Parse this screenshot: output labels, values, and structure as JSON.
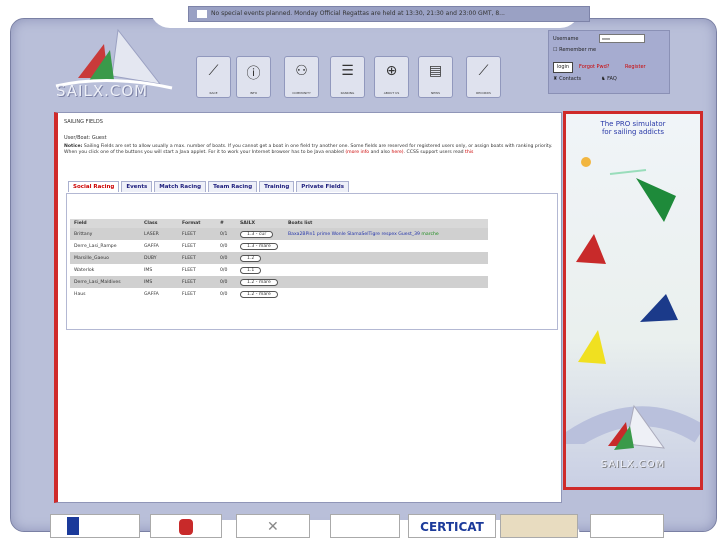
{
  "ticker": {
    "text": "No special events planned. Monday Official Regattas are held at 13:30, 21:30 and 23:00 GMT, 8..."
  },
  "logo": {
    "text": "SAILX.COM"
  },
  "nav": [
    {
      "label": "RACE",
      "icon": "boat-icon"
    },
    {
      "label": "INFO",
      "icon": "info-icon"
    },
    {
      "label": "COMMUNITY",
      "icon": "community-icon"
    },
    {
      "label": "RANKING",
      "icon": "ranking-icon"
    },
    {
      "label": "ABOUT US",
      "icon": "globe-icon"
    },
    {
      "label": "NEWS",
      "icon": "news-icon"
    },
    {
      "label": "RECORDS",
      "icon": "records-icon"
    }
  ],
  "login": {
    "username_label": "Username",
    "username_value": "xxxx",
    "remember": "Remember me",
    "login_btn": "login",
    "forgot": "Forgot Pwd?",
    "register": "Register",
    "contacts": "Contacts",
    "faq": "FAQ"
  },
  "main": {
    "breadcrumb": "SAILING FIELDS",
    "user": "User/Boat: Guest",
    "notice_bold": "Notice:",
    "notice_text": "Sailing Fields are set to allow usually a max. number of boats. If you cannot get a boat in one field try another one. Some fields are reserved for registered users only, or assign boats with ranking priority. When you click one of the buttons you will start a Java applet. For it to work your Internet browser has to be Java enabled",
    "notice_link1": "(more info",
    "notice_mid": "and also",
    "notice_link2": "here)",
    "notice_end": ". CCSS support users read",
    "notice_link3": "this",
    "tabs": [
      "Social Racing",
      "Events",
      "Match Racing",
      "Team Racing",
      "Training",
      "Private Fields"
    ],
    "columns": [
      "Field",
      "Class",
      "Format",
      "#",
      "SAILX",
      "Boats list"
    ],
    "rows": [
      {
        "field": "Brittany",
        "class": "LASER",
        "format": "FLEET",
        "count": "0/1",
        "sail": "1.3 - cur",
        "boats": "Baxa2BPin1 prime Wonle SlamaSelTigre respex Guest_39",
        "boats_green": "marche",
        "gray": true
      },
      {
        "field": "Derre_Lasi_Rampe",
        "class": "GAFFA",
        "format": "FLEET",
        "count": "0/0",
        "sail": "1.3 - mare",
        "boats": "",
        "boats_green": "",
        "gray": false
      },
      {
        "field": "Marsille_Gaeuo",
        "class": "DUBY",
        "format": "FLEET",
        "count": "0/0",
        "sail": "1.2",
        "boats": "",
        "boats_green": "",
        "gray": true
      },
      {
        "field": "Waterlok",
        "class": "IMS",
        "format": "FLEET",
        "count": "0/0",
        "sail": "1.1",
        "boats": "",
        "boats_green": "",
        "gray": false
      },
      {
        "field": "Derre_Lasi_Maldives",
        "class": "IMS",
        "format": "FLEET",
        "count": "0/0",
        "sail": "1.2 - mare",
        "boats": "",
        "boats_green": "",
        "gray": true
      },
      {
        "field": "Haus",
        "class": "GAFFA",
        "format": "FLEET",
        "count": "0/0",
        "sail": "1.2 - mare",
        "boats": "",
        "boats_green": "",
        "gray": false
      }
    ]
  },
  "ad": {
    "title_l1": "The PRO simulator",
    "title_l2": "for sailing addicts",
    "logo": "SAILX.COM"
  },
  "bottom": {
    "cert": "CERTICAT"
  },
  "colors": {
    "frame": "#b9bfd9",
    "accent_red": "#cf2a2a",
    "tab_blue": "#1b1b7a"
  }
}
